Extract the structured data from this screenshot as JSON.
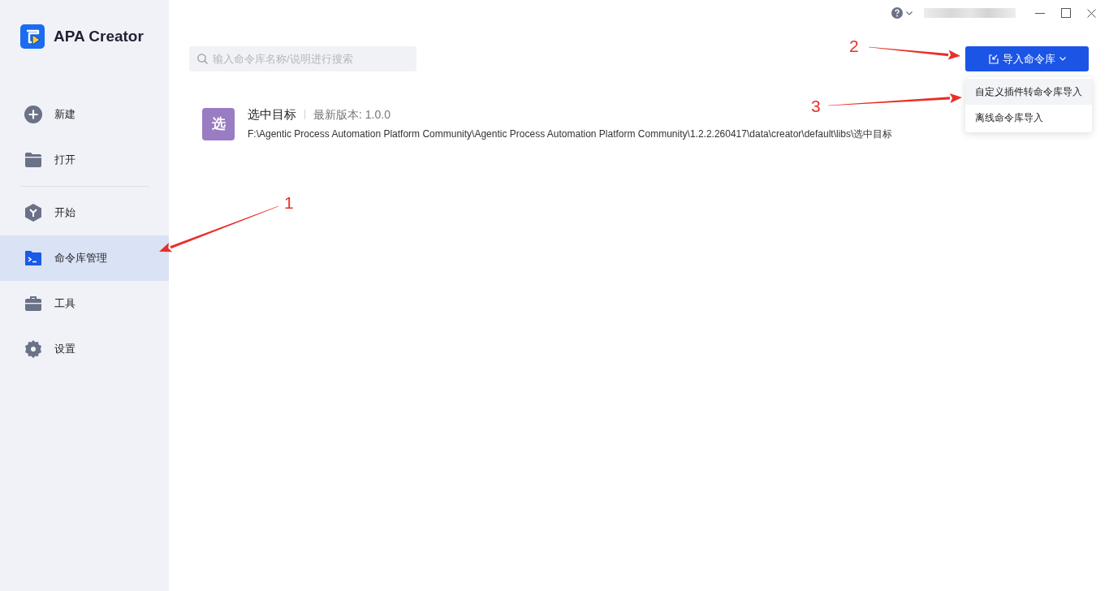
{
  "app": {
    "name": "APA Creator"
  },
  "sidebar": {
    "groups": [
      [
        {
          "label": "新建",
          "selected": false
        },
        {
          "label": "打开",
          "selected": false
        }
      ],
      [
        {
          "label": "开始",
          "selected": false
        },
        {
          "label": "命令库管理",
          "selected": true
        },
        {
          "label": "工具",
          "selected": false
        },
        {
          "label": "设置",
          "selected": false
        }
      ]
    ]
  },
  "search": {
    "placeholder": "输入命令库名称/说明进行搜索"
  },
  "import_button": {
    "label": "导入命令库",
    "expanded": true
  },
  "import_menu": [
    {
      "label": "自定义插件转命令库导入",
      "highlighted": true
    },
    {
      "label": "离线命令库导入",
      "highlighted": false
    }
  ],
  "libraries": [
    {
      "badge": "选",
      "name": "选中目标",
      "version": "最新版本: 1.0.0",
      "path": "F:\\Agentic Process Automation Platform Community\\Agentic Process Automation Platform Community\\1.2.2.260417\\data\\creator\\default\\libs\\选中目标"
    }
  ],
  "annotations": [
    {
      "label": "1"
    },
    {
      "label": "2"
    },
    {
      "label": "3"
    }
  ]
}
